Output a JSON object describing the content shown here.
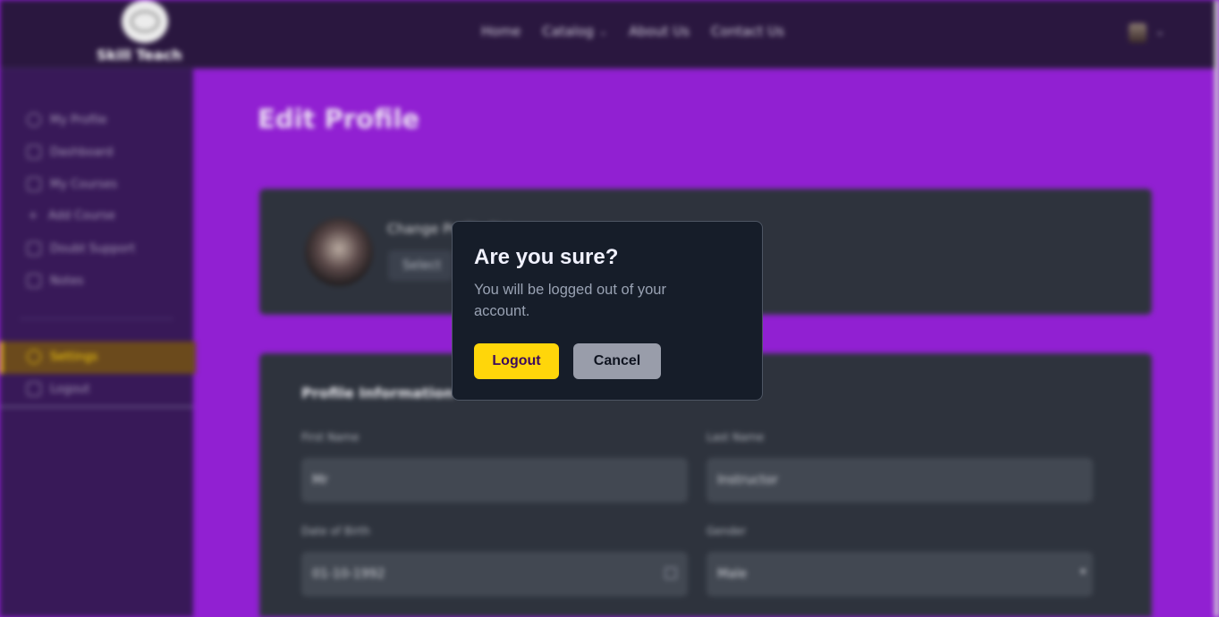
{
  "navbar": {
    "brand": "Skill Teach",
    "links": [
      {
        "label": "Home"
      },
      {
        "label": "Catalog",
        "has_dropdown": true
      },
      {
        "label": "About Us"
      },
      {
        "label": "Contact Us"
      }
    ]
  },
  "sidebar": {
    "items": [
      {
        "label": "My Profile",
        "icon": "user-icon"
      },
      {
        "label": "Dashboard",
        "icon": "dashboard-icon"
      },
      {
        "label": "My Courses",
        "icon": "courses-icon"
      },
      {
        "label": "Add Course",
        "icon": "plus-icon"
      },
      {
        "label": "Doubt Support",
        "icon": "chat-icon"
      },
      {
        "label": "Notes",
        "icon": "notes-icon"
      }
    ],
    "settings_label": "Settings",
    "logout_label": "Logout"
  },
  "main": {
    "title": "Edit Profile",
    "picture_card": {
      "change_label": "Change Profile Picture",
      "select_label": "Select"
    },
    "info_card": {
      "title": "Profile Information",
      "first_name_label": "First Name",
      "first_name_value": "Mr",
      "last_name_label": "Last Name",
      "last_name_value": "Instructor",
      "dob_label": "Date of Birth",
      "dob_value": "01-10-1992",
      "gender_label": "Gender",
      "gender_value": "Male"
    }
  },
  "modal": {
    "title": "Are you sure?",
    "text": "You will be logged out of your account.",
    "confirm_label": "Logout",
    "cancel_label": "Cancel"
  },
  "colors": {
    "accent_yellow": "#ffd60a",
    "main_purple": "#9120d2",
    "modal_bg": "#161d29"
  }
}
